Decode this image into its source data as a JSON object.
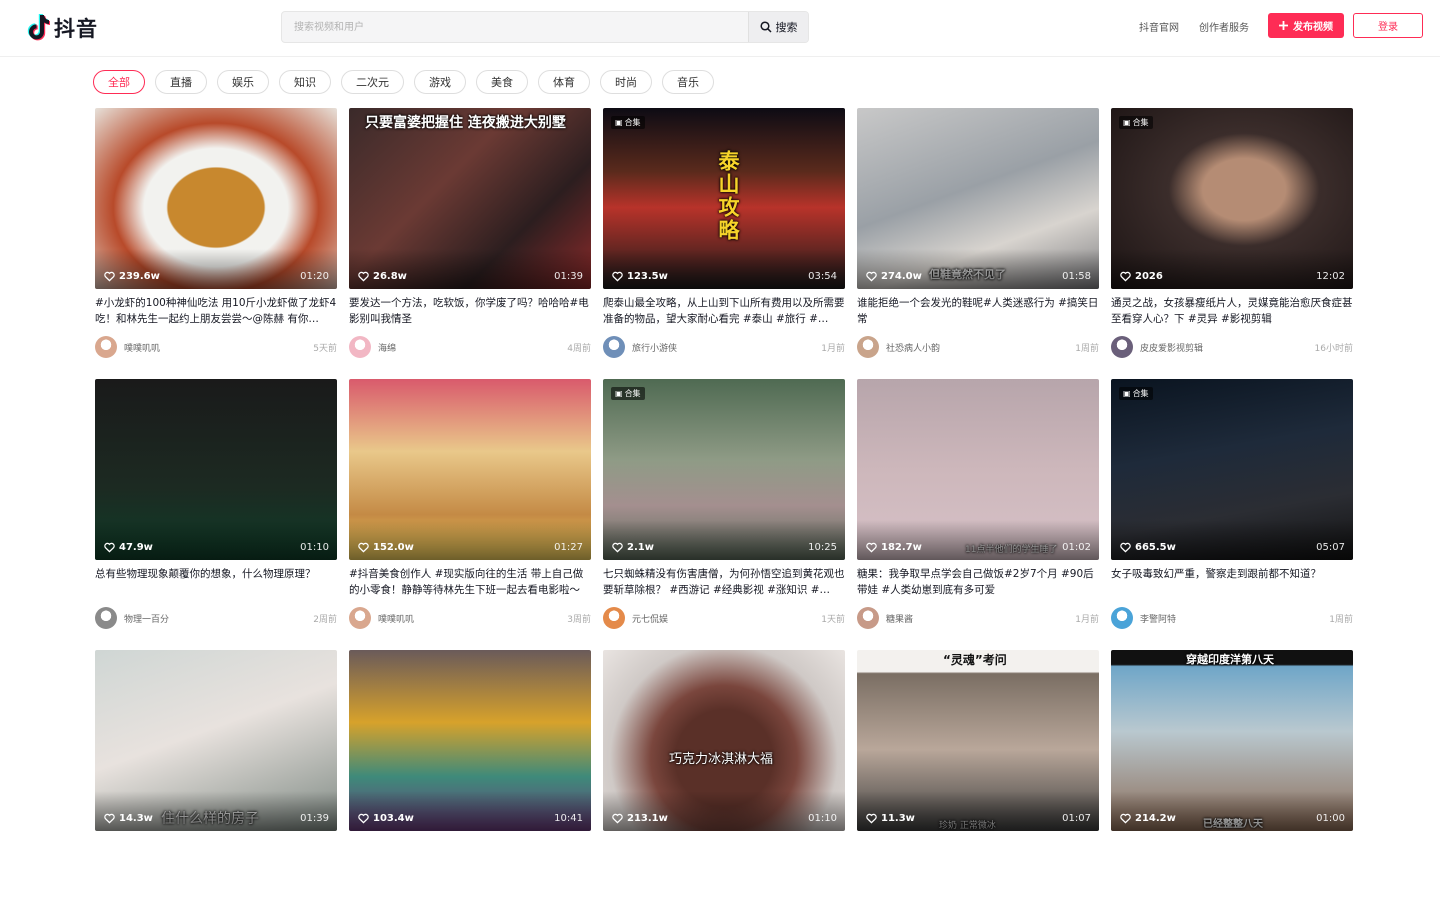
{
  "header": {
    "app_name": "抖音",
    "search_placeholder": "搜索视频和用户",
    "search_button": "搜索",
    "links": [
      "抖音官网",
      "创作者服务"
    ],
    "publish_label": "发布视频",
    "login_label": "登录"
  },
  "categories": [
    "全部",
    "直播",
    "娱乐",
    "知识",
    "二次元",
    "游戏",
    "美食",
    "体育",
    "时尚",
    "音乐"
  ],
  "active_category": "全部",
  "colors": {
    "accent": "#fe2c55"
  },
  "videos": [
    {
      "likes": "239.6w",
      "duration": "01:20",
      "title": "#小龙虾的100种神仙吃法 用10斤小龙虾做了龙虾4吃！和林先生一起约上朋友尝尝～@陈赫 有你…",
      "author": "噗噗叽叽",
      "time": "5天前",
      "badge": "",
      "overlay": ""
    },
    {
      "likes": "26.8w",
      "duration": "01:39",
      "title": "要发达一个方法，吃软饭，你学废了吗？哈哈哈#电影别叫我情圣",
      "author": "海绵",
      "time": "4周前",
      "badge": "",
      "overlay": "只要富婆把握住 连夜搬进大别墅"
    },
    {
      "likes": "123.5w",
      "duration": "03:54",
      "title": "爬泰山最全攻略，从上山到下山所有费用以及所需要准备的物品，望大家耐心看完 #泰山 #旅行 #…",
      "author": "旅行小游侠",
      "time": "1月前",
      "badge": "合集",
      "overlay": "泰山攻略"
    },
    {
      "likes": "274.0w",
      "duration": "01:58",
      "title": "谁能拒绝一个会发光的鞋呢#人类迷惑行为 #搞笑日常",
      "author": "社恐病人小韵",
      "time": "1周前",
      "badge": "",
      "overlay": "但鞋竟然不见了"
    },
    {
      "likes": "2026",
      "duration": "12:02",
      "title": "通灵之战，女孩暴瘦纸片人，灵媒竟能治愈厌食症甚至看穿人心？下 #灵异 #影视剪辑",
      "author": "皮皮爱影视剪辑",
      "time": "16小时前",
      "badge": "合集",
      "overlay": ""
    },
    {
      "likes": "47.9w",
      "duration": "01:10",
      "title": "总有些物理现象颠覆你的想象，什么物理原理？",
      "author": "物理一百分",
      "time": "2周前",
      "badge": "",
      "overlay": ""
    },
    {
      "likes": "152.0w",
      "duration": "01:27",
      "title": "#抖音美食创作人 #现实版向往的生活 带上自己做的小零食！静静等待林先生下班一起去看电影啦～",
      "author": "噗噗叽叽",
      "time": "3周前",
      "badge": "",
      "overlay": ""
    },
    {
      "likes": "2.1w",
      "duration": "10:25",
      "title": "七只蜘蛛精没有伤害唐僧，为何孙悟空追到黄花观也要斩草除根？ #西游记 #经典影视 #涨知识 #…",
      "author": "元七侃娱",
      "time": "1天前",
      "badge": "合集",
      "overlay": ""
    },
    {
      "likes": "182.7w",
      "duration": "01:02",
      "title": "糖果：我争取早点学会自己做饭#2岁7个月 #90后带娃 #人类幼崽到底有多可爱",
      "author": "糖果酱",
      "time": "1月前",
      "badge": "",
      "overlay": "11点半他们的学生睡了"
    },
    {
      "likes": "665.5w",
      "duration": "05:07",
      "title": "女子吸毒致幻严重，警察走到跟前都不知道？",
      "author": "李警阿特",
      "time": "1周前",
      "badge": "合集",
      "overlay": ""
    },
    {
      "likes": "14.3w",
      "duration": "01:39",
      "title": "",
      "author": "",
      "time": "",
      "badge": "",
      "overlay": "住什么样的房子"
    },
    {
      "likes": "103.4w",
      "duration": "10:41",
      "title": "",
      "author": "",
      "time": "",
      "badge": "",
      "overlay": ""
    },
    {
      "likes": "213.1w",
      "duration": "01:10",
      "title": "",
      "author": "",
      "time": "",
      "badge": "",
      "overlay": "巧克力冰淇淋大福"
    },
    {
      "likes": "11.3w",
      "duration": "01:07",
      "title": "",
      "author": "",
      "time": "",
      "badge": "",
      "overlay": "“灵魂”考问"
    },
    {
      "likes": "214.2w",
      "duration": "01:00",
      "title": "",
      "author": "",
      "time": "",
      "badge": "",
      "overlay": "穿越印度洋第八天"
    }
  ],
  "extra_overlays": {
    "card_13_bottom": "珍奶 正常微冰",
    "card_14_bottom": "已经整整八天"
  }
}
